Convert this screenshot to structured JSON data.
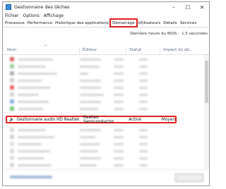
{
  "window": {
    "title": "Gestionnaire des tâches",
    "controls": {
      "minimize": "–",
      "maximize": "☐",
      "close": "✕"
    }
  },
  "menu": [
    "Fichier",
    "Options",
    "Affichage"
  ],
  "tabs": [
    {
      "label": "Processus"
    },
    {
      "label": "Performance"
    },
    {
      "label": "Historique des applications"
    },
    {
      "label": "Démarrage",
      "active": true
    },
    {
      "label": "Utilisateurs"
    },
    {
      "label": "Détails"
    },
    {
      "label": "Services"
    }
  ],
  "bios": {
    "label": "Dernière heure du BIOS :",
    "value": "1.5 secondes"
  },
  "columns": {
    "name": "Nom",
    "publisher": "Éditeur",
    "status": "Statut",
    "impact": "Impact du dé..."
  },
  "highlighted_row": {
    "name": "Gestionnaire audio HD Realtek",
    "publisher": "Realtek Semiconductor",
    "status": "Activé",
    "impact": "Moyen"
  },
  "colors": {
    "highlight": "#e02020"
  }
}
